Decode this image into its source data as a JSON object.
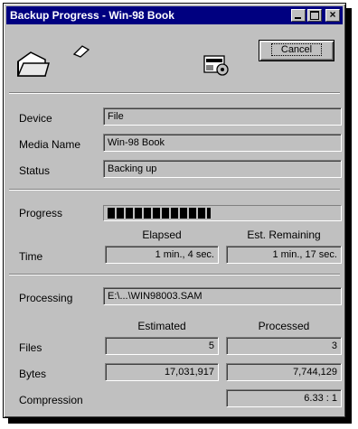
{
  "window": {
    "title": "Backup Progress - Win-98 Book"
  },
  "buttons": {
    "cancel_label": "Cancel"
  },
  "details": {
    "device_label": "Device",
    "device_value": "File",
    "media_label": "Media Name",
    "media_value": "Win-98 Book",
    "status_label": "Status",
    "status_value": "Backing up"
  },
  "progress": {
    "label": "Progress",
    "fraction": 0.45,
    "elapsed_header": "Elapsed",
    "remaining_header": "Est. Remaining",
    "time_label": "Time",
    "elapsed_value": "1 min., 4 sec.",
    "remaining_value": "1 min., 17 sec."
  },
  "processing": {
    "label": "Processing",
    "value": "E:\\...\\WIN98003.SAM",
    "estimated_header": "Estimated",
    "processed_header": "Processed",
    "files_label": "Files",
    "files_estimated": "5",
    "files_processed": "3",
    "bytes_label": "Bytes",
    "bytes_estimated": "17,031,917",
    "bytes_processed": "7,744,129",
    "compression_label": "Compression",
    "compression_value": "6.33 : 1"
  },
  "icons": {
    "source": "folder-icon",
    "animation": "flying-paper-icon",
    "destination": "backup-file-icon"
  }
}
